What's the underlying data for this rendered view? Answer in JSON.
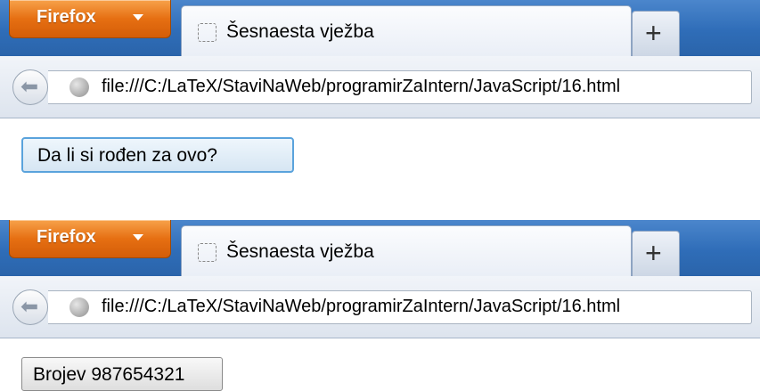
{
  "screenshots": [
    {
      "menu_button_label": "Firefox",
      "tab_title": "Šesnaesta vježba",
      "new_tab_symbol": "+",
      "url": "file:///C:/LaTeX/StaviNaWeb/programirZaIntern/JavaScript/16.html",
      "page_button_label": "Da li si rođen za ovo?",
      "page_button_state": "focused"
    },
    {
      "menu_button_label": "Firefox",
      "tab_title": "Šesnaesta vježba",
      "new_tab_symbol": "+",
      "url": "file:///C:/LaTeX/StaviNaWeb/programirZaIntern/JavaScript/16.html",
      "page_button_label": "Brojev 987654321",
      "page_button_state": "normal"
    }
  ],
  "icons": {
    "menu_dropdown": "chevron-down-icon",
    "tab_favicon": "blank-page-icon",
    "back": "back-arrow-icon",
    "site_identity": "globe-icon"
  },
  "colors": {
    "firefox_button": "#e66f12",
    "tab_strip": "#3a74bf",
    "focused_button_border": "#5aa3dc"
  }
}
